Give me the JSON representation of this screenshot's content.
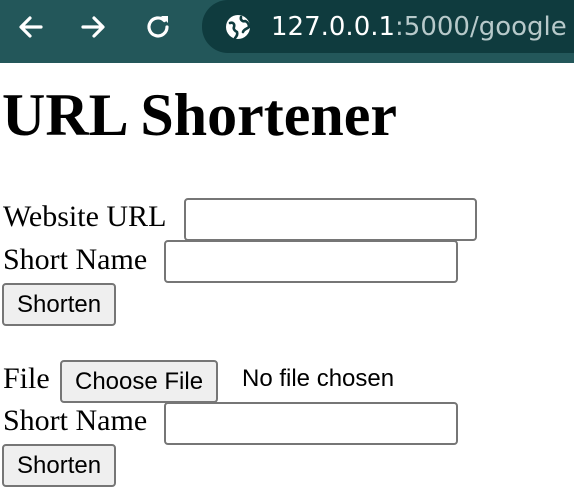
{
  "browser": {
    "url_host": "127.0.0.1",
    "url_rest": ":5000/google"
  },
  "page": {
    "title": "URL Shortener",
    "form_url": {
      "website_url_label": "Website URL",
      "website_url_value": "",
      "short_name_label": "Short Name",
      "short_name_value": "",
      "submit_label": "Shorten"
    },
    "form_file": {
      "file_label": "File",
      "choose_file_label": "Choose File",
      "file_status": "No file chosen",
      "short_name_label": "Short Name",
      "short_name_value": "",
      "submit_label": "Shorten"
    }
  }
}
